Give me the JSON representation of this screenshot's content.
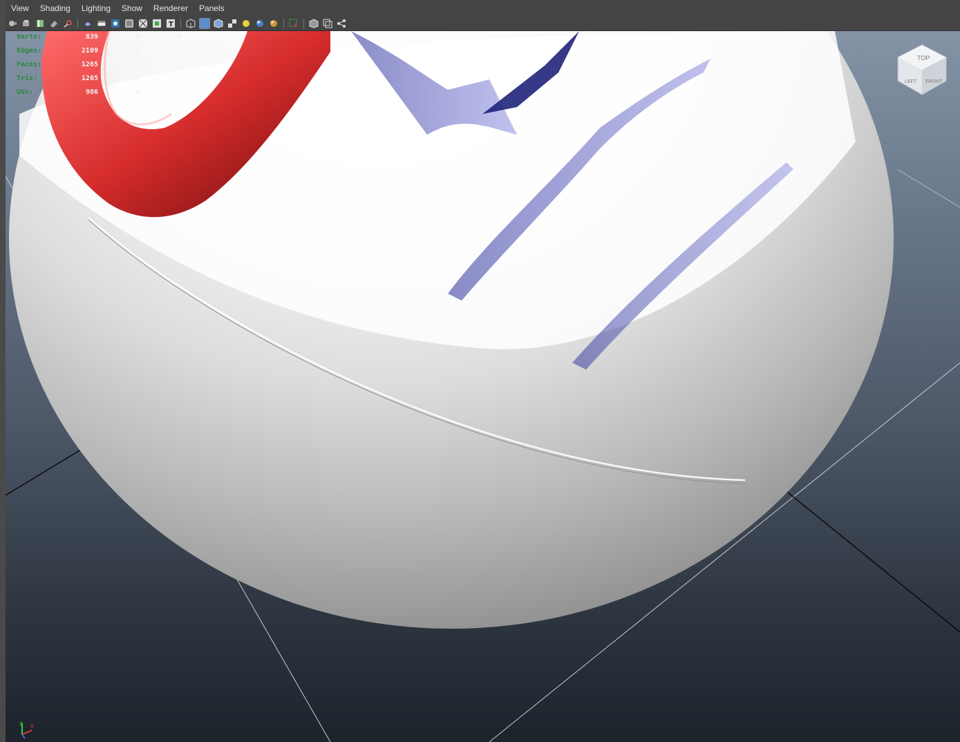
{
  "menu": [
    "View",
    "Shading",
    "Lighting",
    "Show",
    "Renderer",
    "Panels"
  ],
  "toolbar": {
    "groups": [
      [
        "camera-select-icon",
        "camera-attributes-icon",
        "bookmark-icon",
        "image-plane-icon",
        "grid-toggle-icon"
      ],
      [
        "wireframe-icon",
        "film-gate-icon",
        "resolution-gate-icon",
        "gate-mask-icon",
        "field-chart-icon",
        "safe-action-icon",
        "text-icon"
      ],
      [
        "wireframe-cube-icon",
        "smooth-shade-icon",
        "shaded-wire-icon",
        "textured-icon",
        "default-light-icon",
        "all-lights-icon",
        "shadows-icon"
      ],
      [
        "isolate-select-icon"
      ],
      [
        "xray-icon",
        "backface-icon",
        "joints-icon"
      ]
    ],
    "active": [
      "smooth-shade-icon"
    ]
  },
  "hud": {
    "rows": [
      {
        "label": "Verts:",
        "v1": "839",
        "v2": "0",
        "v3": "0"
      },
      {
        "label": "Edges:",
        "v1": "2109",
        "v2": "0",
        "v3": ""
      },
      {
        "label": "Faces:",
        "v1": "1265",
        "v2": "0",
        "v3": ""
      },
      {
        "label": "Tris:",
        "v1": "1265",
        "v2": "0",
        "v3": ""
      },
      {
        "label": "UVs:",
        "v1": "986",
        "v2": "0",
        "v3": ""
      }
    ]
  },
  "viewcube": {
    "top": "TOP",
    "front": "FRONT",
    "left": "LEFT"
  },
  "axis": {
    "x": "x",
    "y": "y"
  },
  "colors": {
    "accent": "#6a8ab8",
    "hud_label": "#2a8a3a",
    "handle": "#d23b3b",
    "stripe": "#2a2f9a"
  }
}
